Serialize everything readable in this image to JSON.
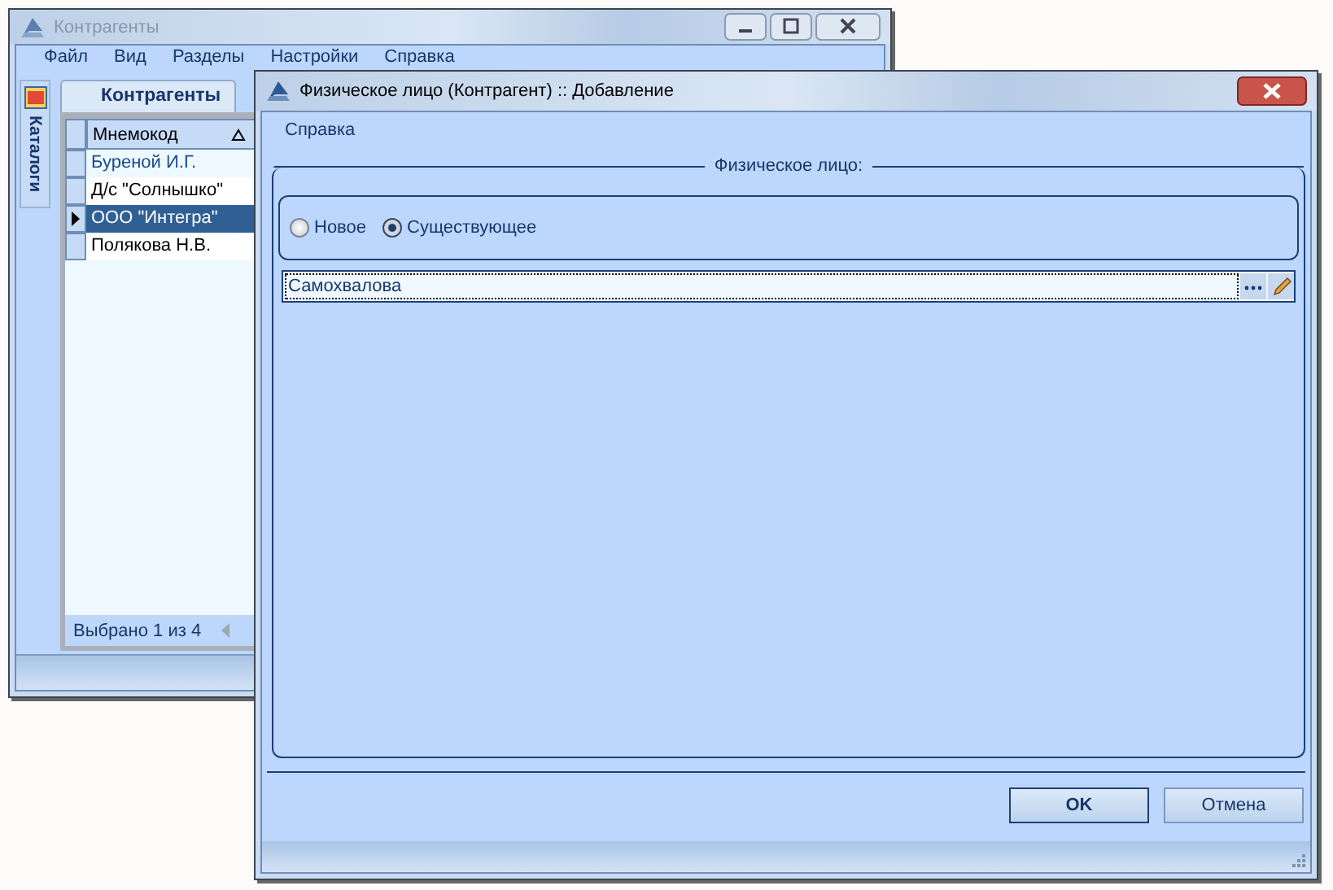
{
  "back_window": {
    "title": "Контрагенты",
    "menu": [
      "Файл",
      "Вид",
      "Разделы",
      "Настройки",
      "Справка"
    ],
    "side_tab": {
      "label": "Каталоги"
    },
    "tab": {
      "label": "Контрагенты",
      "selected": true
    },
    "grid": {
      "column": "Мнемокод",
      "rows": [
        {
          "text": "Буреной И.Г.",
          "selected": false,
          "highlighted": true
        },
        {
          "text": "Д/с \"Солнышко\"",
          "selected": false,
          "highlighted": false
        },
        {
          "text": "ООО \"Интегра\"",
          "selected": true,
          "highlighted": false
        },
        {
          "text": "Полякова Н.В.",
          "selected": false,
          "highlighted": false
        }
      ]
    },
    "footer": "Выбрано 1 из 4"
  },
  "dialog": {
    "title": "Физическое лицо (Контрагент) :: Добавление",
    "menu": [
      "Справка"
    ],
    "group": {
      "title": "Физическое лицо:",
      "options": [
        {
          "label": "Новое",
          "selected": false
        },
        {
          "label": "Существующее",
          "selected": true
        }
      ],
      "field": {
        "value": "Самохвалова"
      }
    },
    "buttons": [
      {
        "label": "OK",
        "kind": "default"
      },
      {
        "label": "Отмена",
        "kind": "normal"
      }
    ]
  }
}
